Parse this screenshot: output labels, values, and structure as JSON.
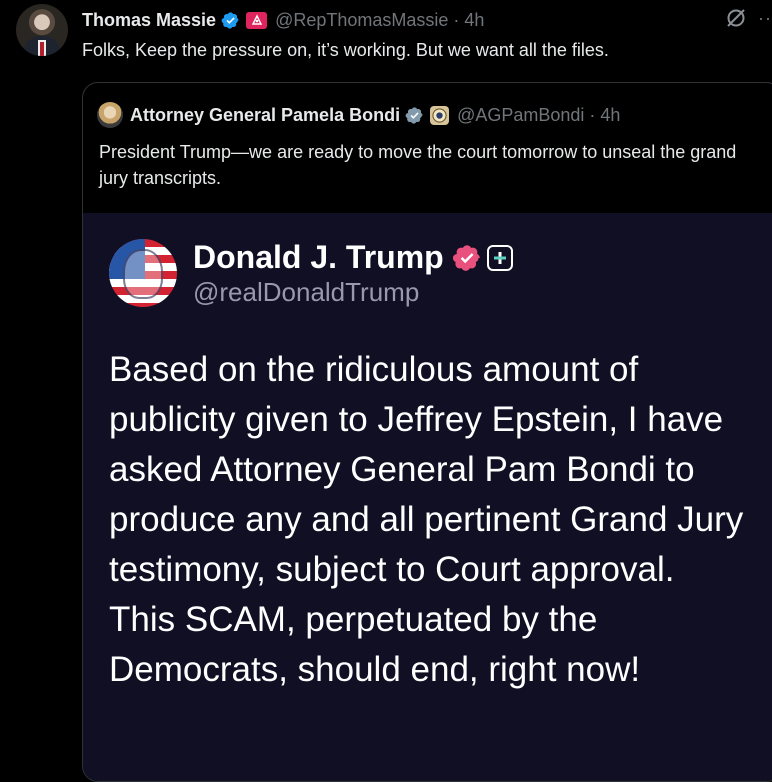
{
  "outer_post": {
    "author_name": "Thomas Massie",
    "handle": "@RepThomasMassie",
    "time": "· 4h",
    "text": "Folks, Keep the pressure on, it’s working. But we want all the files.",
    "more_label": "··"
  },
  "quoted_post": {
    "author_name": "Attorney General Pamela Bondi",
    "handle": "@AGPamBondi",
    "time": "· 4h",
    "text": "President Trump—we are ready to move the court tomorrow to unseal the grand jury transcripts."
  },
  "embedded_truth": {
    "author_name": "Donald J. Trump",
    "handle": "@realDonaldTrump",
    "text": "Based on the ridiculous amount of publicity given to Jeffrey Epstein, I have asked Attorney General Pam Bondi to produce any and all pertinent Grand Jury testimony, subject to Court approval. This SCAM, perpetuated by the Democrats, should end, right now!"
  },
  "icons": {
    "verified": "verified-badge-icon",
    "affiliate": "congress-affiliate-icon",
    "doj": "doj-seal-icon",
    "grok": "grok-icon",
    "more": "more-icon",
    "truth_verified": "truth-verified-icon",
    "truth_plus": "plus-icon"
  },
  "colors": {
    "background": "#000000",
    "text": "#e7e9ea",
    "secondary": "#71767b",
    "verified_blue": "#1d9bf0",
    "truth_bg": "#110f24",
    "truth_pink": "#e8507e"
  }
}
